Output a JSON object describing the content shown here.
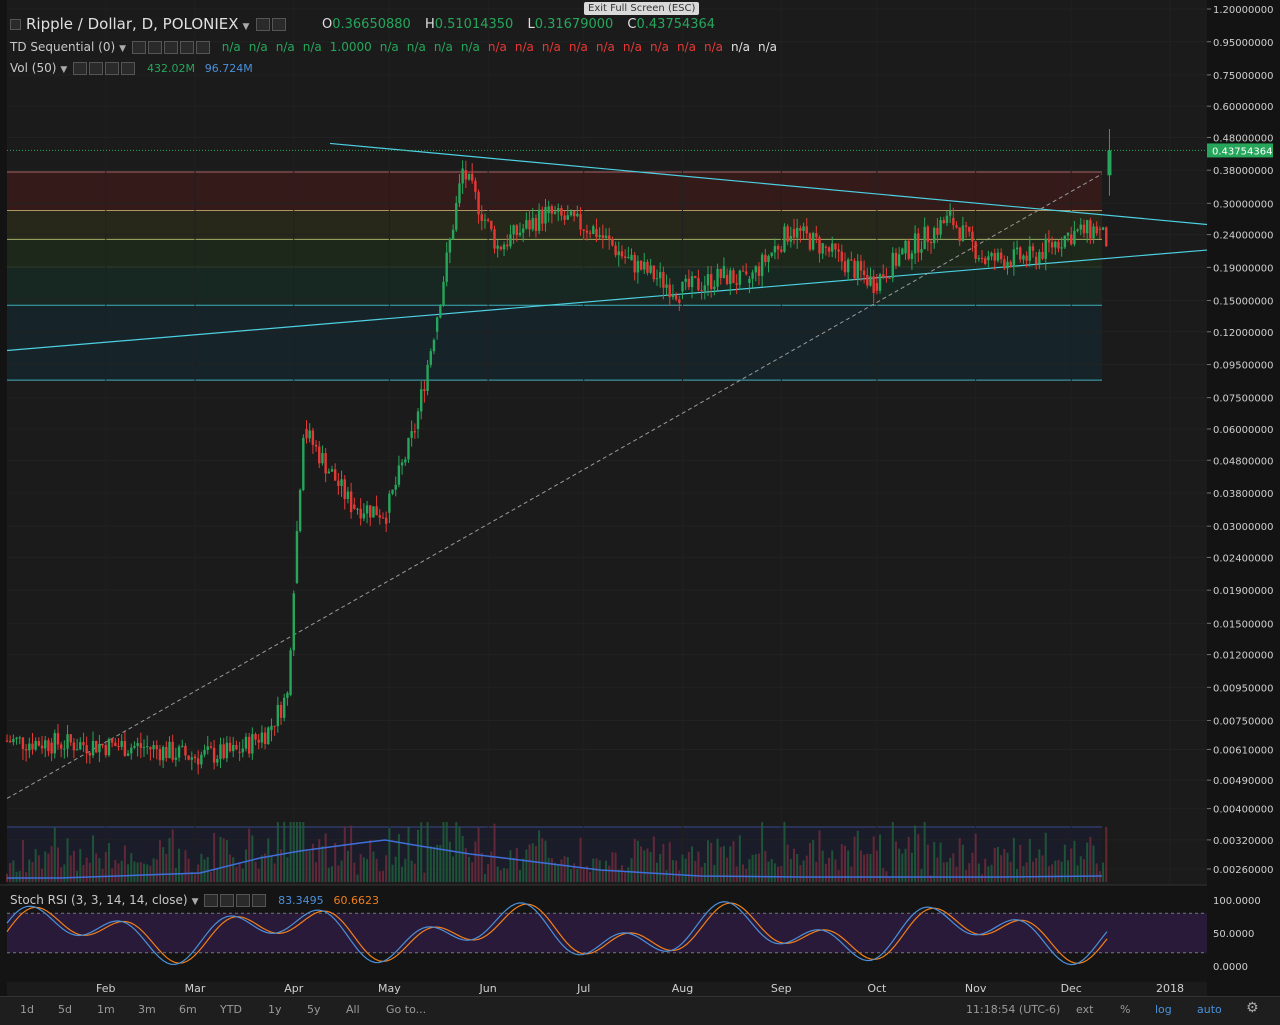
{
  "header": {
    "title": "Ripple / Dollar, D, POLONIEX",
    "ohlc": [
      {
        "k": "O",
        "v": "0.36650880"
      },
      {
        "k": "H",
        "v": "0.51014350"
      },
      {
        "k": "L",
        "v": "0.31679000"
      },
      {
        "k": "C",
        "v": "0.43754364"
      }
    ],
    "exit_fullscreen": "Exit Full Screen (ESC)"
  },
  "indicators": {
    "td": {
      "label": "TD Sequential (0)",
      "values": [
        {
          "t": "n/a",
          "c": "g"
        },
        {
          "t": "n/a",
          "c": "g"
        },
        {
          "t": "n/a",
          "c": "g"
        },
        {
          "t": "n/a",
          "c": "g"
        },
        {
          "t": "1.0000",
          "c": "g"
        },
        {
          "t": "n/a",
          "c": "g"
        },
        {
          "t": "n/a",
          "c": "g"
        },
        {
          "t": "n/a",
          "c": "g"
        },
        {
          "t": "n/a",
          "c": "g"
        },
        {
          "t": "n/a",
          "c": "r"
        },
        {
          "t": "n/a",
          "c": "r"
        },
        {
          "t": "n/a",
          "c": "r"
        },
        {
          "t": "n/a",
          "c": "r"
        },
        {
          "t": "n/a",
          "c": "r"
        },
        {
          "t": "n/a",
          "c": "r"
        },
        {
          "t": "n/a",
          "c": "r"
        },
        {
          "t": "n/a",
          "c": "r"
        },
        {
          "t": "n/a",
          "c": "r"
        },
        {
          "t": "n/a",
          "c": "w"
        },
        {
          "t": "n/a",
          "c": "w"
        }
      ]
    },
    "vol": {
      "label": "Vol (50)",
      "v1": "432.02M",
      "v2": "96.724M",
      "c1": "#26a65b",
      "c2": "#4a90d9"
    },
    "stoch": {
      "label": "Stoch RSI (3, 3, 14, 14, close)",
      "v1": "83.3495",
      "v2": "60.6623",
      "c1": "#4a90d9",
      "c2": "#f07f1a"
    }
  },
  "chart_data": {
    "type": "candlestick",
    "y_scale": "log",
    "price_ticks": [
      "1.20000000",
      "0.95000000",
      "0.75000000",
      "0.60000000",
      "0.48000000",
      "0.38000000",
      "0.30000000",
      "0.24000000",
      "0.19000000",
      "0.15000000",
      "0.12000000",
      "0.09500000",
      "0.07500000",
      "0.06000000",
      "0.04800000",
      "0.03800000",
      "0.03000000",
      "0.02400000",
      "0.01900000",
      "0.01500000",
      "0.01200000",
      "0.00950000",
      "0.00750000",
      "0.00610000",
      "0.00490000",
      "0.00400000",
      "0.00320000",
      "0.00260000"
    ],
    "last_price_label": "0.43754364",
    "x_ticks": [
      "Feb",
      "Mar",
      "Apr",
      "May",
      "Jun",
      "Jul",
      "Aug",
      "Sep",
      "Oct",
      "Nov",
      "Dec",
      "2018"
    ],
    "stoch_ticks": [
      "100.0000",
      "50.0000",
      "0.0000"
    ],
    "series": [
      {
        "x": "2017-01-01",
        "o": 0.0065,
        "c": 0.0064
      },
      {
        "x": "2017-01-15",
        "o": 0.0064,
        "c": 0.0063
      },
      {
        "x": "2017-02-01",
        "o": 0.0063,
        "c": 0.0062
      },
      {
        "x": "2017-02-15",
        "o": 0.0062,
        "c": 0.0058
      },
      {
        "x": "2017-03-01",
        "o": 0.0058,
        "c": 0.006
      },
      {
        "x": "2017-03-15",
        "o": 0.006,
        "c": 0.007
      },
      {
        "x": "2017-03-25",
        "o": 0.007,
        "c": 0.009
      },
      {
        "x": "2017-03-31",
        "o": 0.009,
        "c": 0.02
      },
      {
        "x": "2017-04-02",
        "o": 0.02,
        "c": 0.06
      },
      {
        "x": "2017-04-05",
        "o": 0.06,
        "c": 0.035
      },
      {
        "x": "2017-04-20",
        "o": 0.035,
        "c": 0.033
      },
      {
        "x": "2017-05-01",
        "o": 0.033,
        "c": 0.06
      },
      {
        "x": "2017-05-10",
        "o": 0.06,
        "c": 0.12
      },
      {
        "x": "2017-05-16",
        "o": 0.12,
        "c": 0.38
      },
      {
        "x": "2017-05-25",
        "o": 0.38,
        "c": 0.22
      },
      {
        "x": "2017-06-05",
        "o": 0.22,
        "c": 0.28
      },
      {
        "x": "2017-06-20",
        "o": 0.28,
        "c": 0.25
      },
      {
        "x": "2017-07-05",
        "o": 0.25,
        "c": 0.2
      },
      {
        "x": "2017-07-16",
        "o": 0.2,
        "c": 0.16
      },
      {
        "x": "2017-08-01",
        "o": 0.16,
        "c": 0.18
      },
      {
        "x": "2017-08-15",
        "o": 0.18,
        "c": 0.17
      },
      {
        "x": "2017-08-22",
        "o": 0.17,
        "c": 0.25
      },
      {
        "x": "2017-09-05",
        "o": 0.25,
        "c": 0.22
      },
      {
        "x": "2017-09-15",
        "o": 0.22,
        "c": 0.17
      },
      {
        "x": "2017-10-01",
        "o": 0.17,
        "c": 0.21
      },
      {
        "x": "2017-10-10",
        "o": 0.21,
        "c": 0.27
      },
      {
        "x": "2017-10-25",
        "o": 0.27,
        "c": 0.2
      },
      {
        "x": "2017-11-05",
        "o": 0.2,
        "c": 0.205
      },
      {
        "x": "2017-11-20",
        "o": 0.205,
        "c": 0.24
      },
      {
        "x": "2017-12-01",
        "o": 0.24,
        "c": 0.25
      },
      {
        "x": "2017-12-10",
        "o": 0.25,
        "c": 0.23
      },
      {
        "x": "2017-12-13",
        "o": 0.3665,
        "c": 0.4375
      }
    ]
  },
  "bottom": {
    "ranges": [
      "1d",
      "5d",
      "1m",
      "3m",
      "6m",
      "YTD",
      "1y",
      "5y",
      "All"
    ],
    "goto": "Go to...",
    "time": "11:18:54 (UTC-6)",
    "right": [
      "ext",
      "%",
      "log",
      "auto"
    ]
  },
  "colors": {
    "up": "#26a65b",
    "down": "#e53935",
    "line": "#4dd0e1",
    "volline": "#3f6fd8"
  }
}
